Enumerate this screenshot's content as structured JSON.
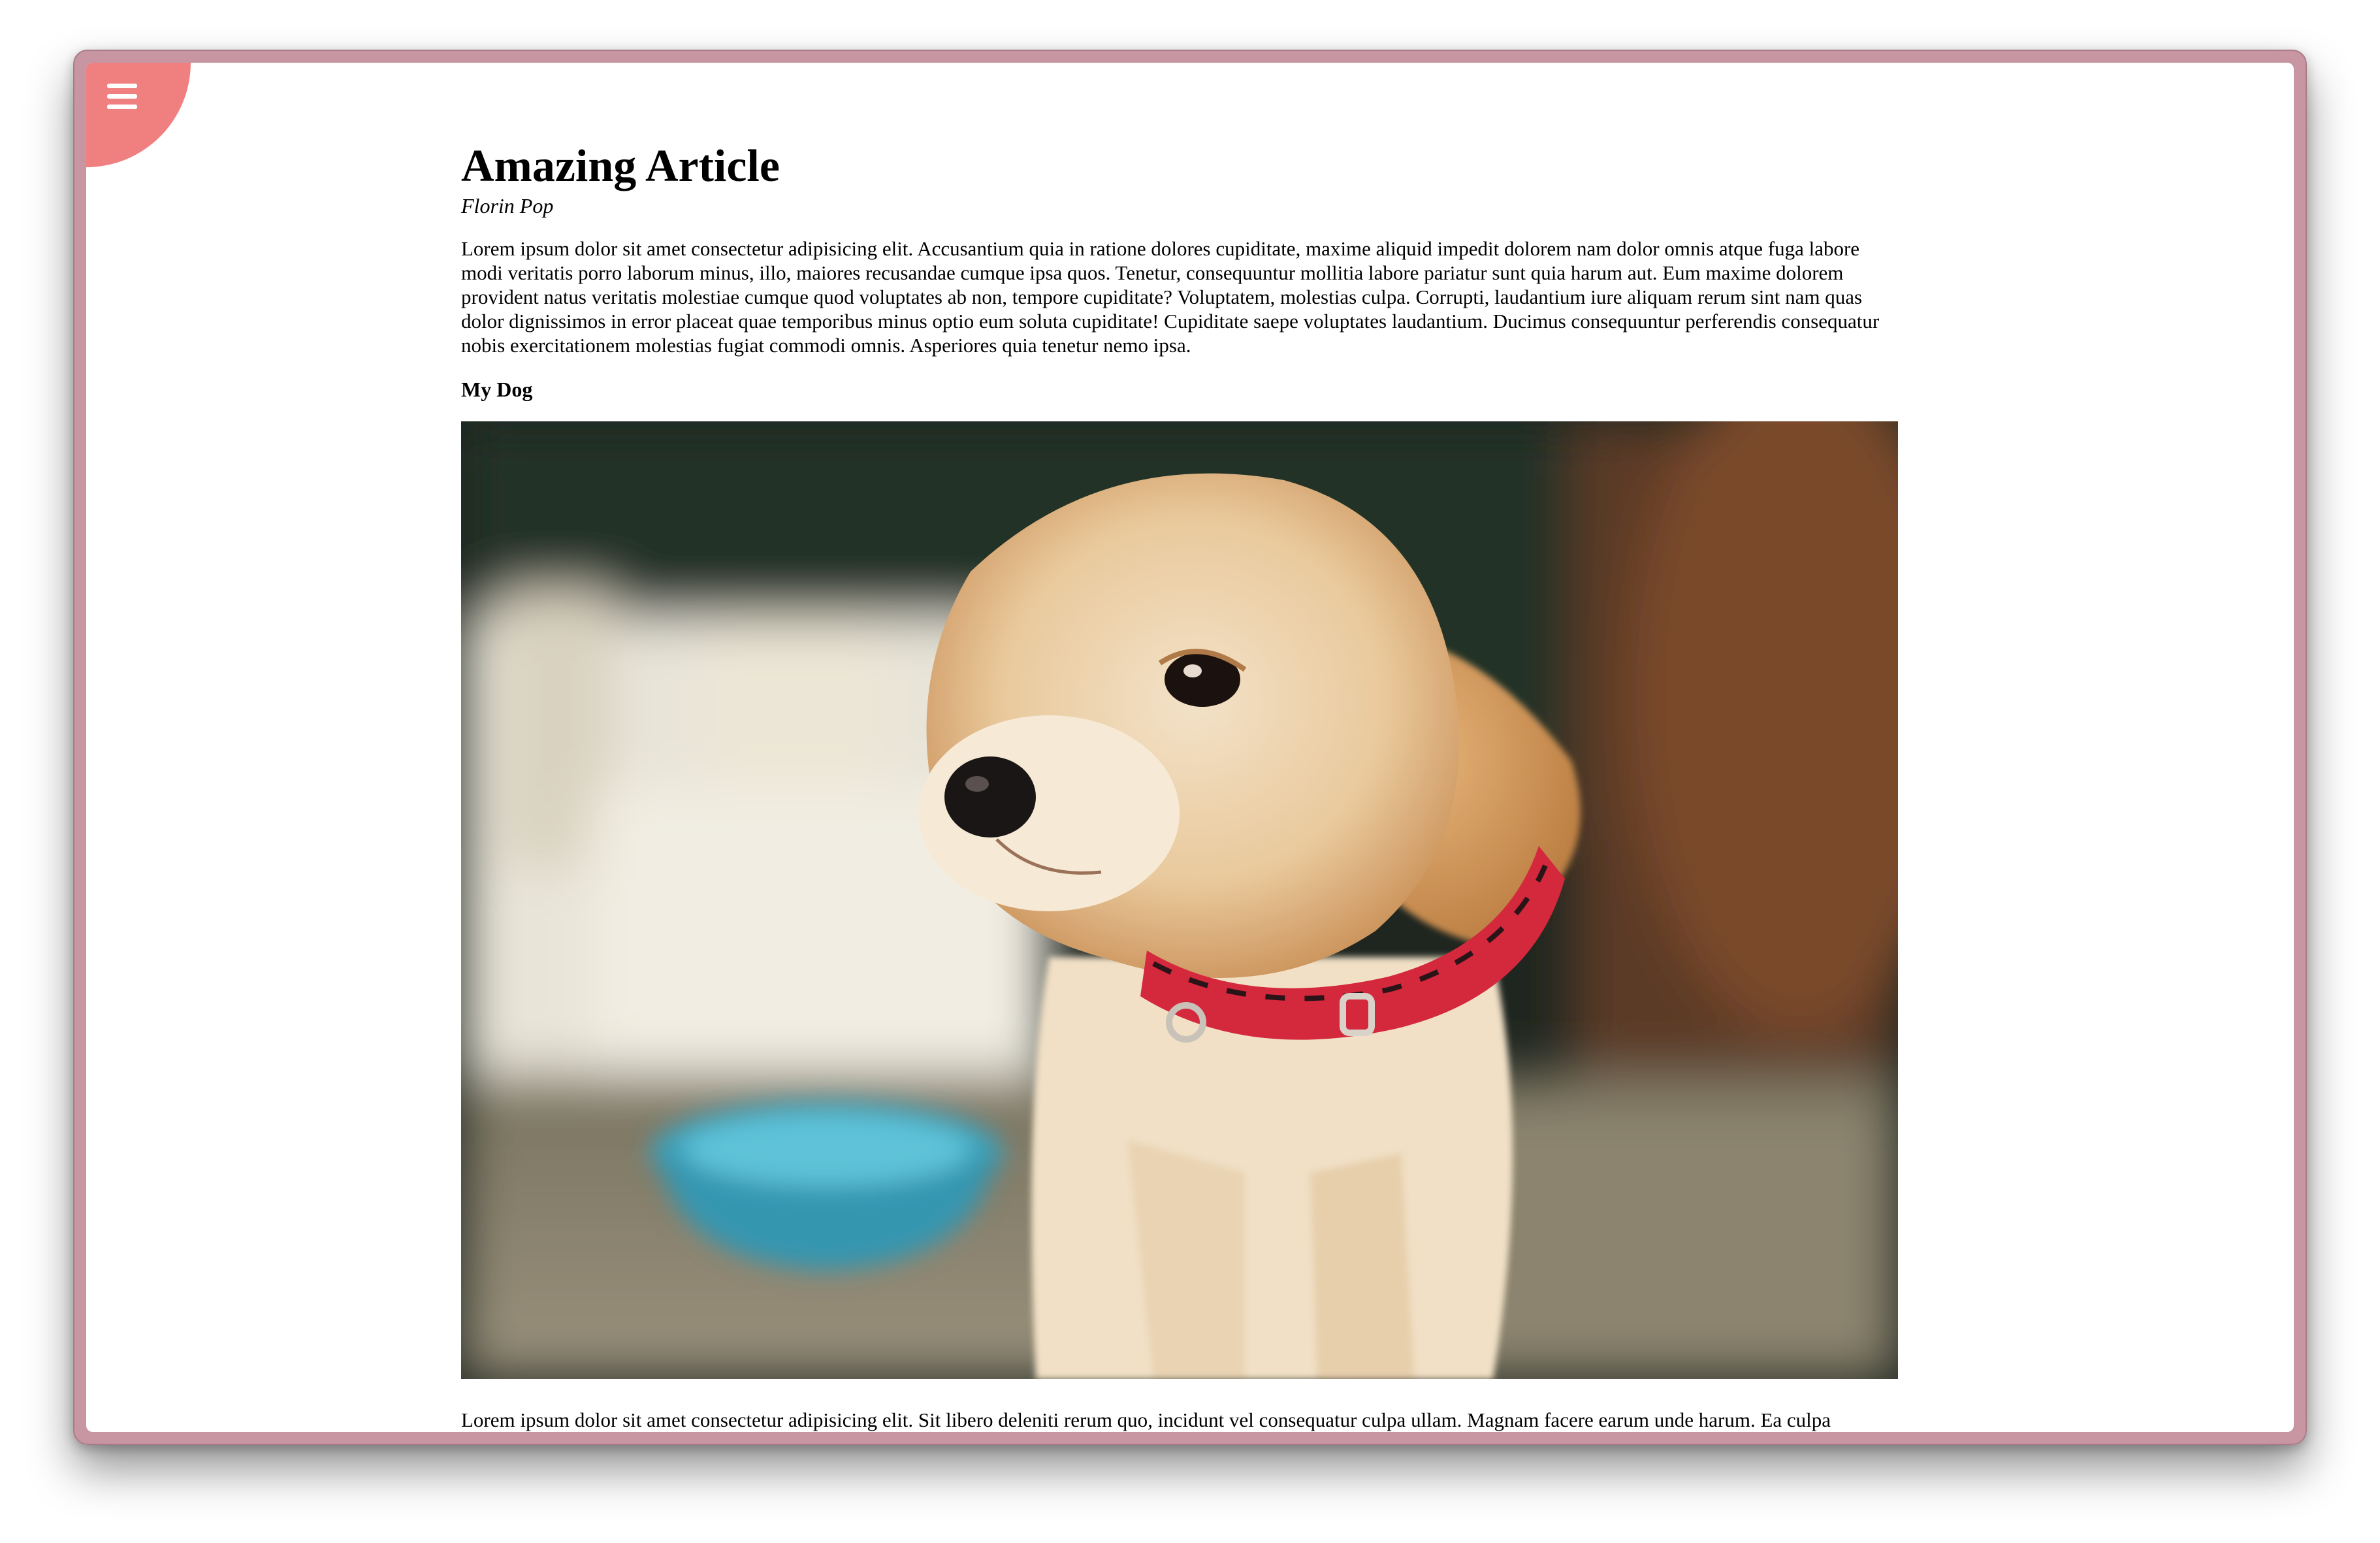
{
  "menu": {
    "icon": "hamburger-menu-icon",
    "color": "#f08080"
  },
  "article": {
    "title": "Amazing Article",
    "author": "Florin Pop",
    "paragraph1": "Lorem ipsum dolor sit amet consectetur adipisicing elit. Accusantium quia in ratione dolores cupiditate, maxime aliquid impedit dolorem nam dolor omnis atque fuga labore modi veritatis porro laborum minus, illo, maiores recusandae cumque ipsa quos. Tenetur, consequuntur mollitia labore pariatur sunt quia harum aut. Eum maxime dolorem provident natus veritatis molestiae cumque quod voluptates ab non, tempore cupiditate? Voluptatem, molestias culpa. Corrupti, laudantium iure aliquam rerum sint nam quas dolor dignissimos in error placeat quae temporibus minus optio eum soluta cupiditate! Cupiditate saepe voluptates laudantium. Ducimus consequuntur perferendis consequatur nobis exercitationem molestias fugiat commodi omnis. Asperiores quia tenetur nemo ipsa.",
    "caption": "My Dog",
    "image_subject": "puppy-photo",
    "paragraph2": "Lorem ipsum dolor sit amet consectetur adipisicing elit. Sit libero deleniti rerum quo, incidunt vel consequatur culpa ullam. Magnam facere earum unde harum. Ea culpa"
  }
}
